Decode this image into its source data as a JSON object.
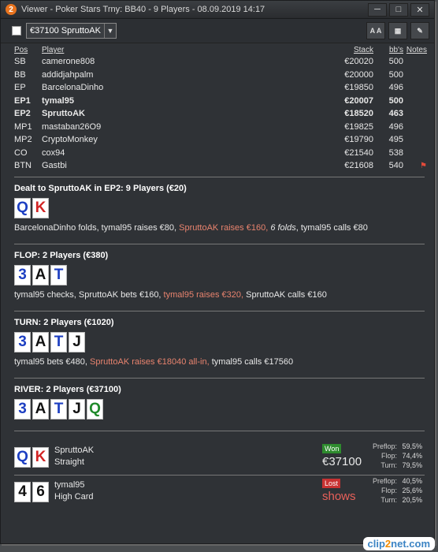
{
  "window": {
    "app_icon": "2",
    "title": "Viewer - Poker Stars Trny: BB40 - 9 Players - 08.09.2019 14:17",
    "buttons": [
      "minimize-icon",
      "maximize-icon",
      "close-icon"
    ]
  },
  "toolbar": {
    "selected_hand": "€37100 SpruttoAK",
    "font_button": "A A"
  },
  "table": {
    "headers": {
      "pos": "Pos",
      "player": "Player",
      "stack": "Stack",
      "bbs": "bb's",
      "notes": "Notes"
    },
    "rows": [
      {
        "pos": "SB",
        "player": "camerone808",
        "stack": "€20020",
        "bbs": "500",
        "bold": false
      },
      {
        "pos": "BB",
        "player": "addidjahpalm",
        "stack": "€20000",
        "bbs": "500",
        "bold": false
      },
      {
        "pos": "EP",
        "player": "BarcelonaDinho",
        "stack": "€19850",
        "bbs": "496",
        "bold": false
      },
      {
        "pos": "EP1",
        "player": "tymal95",
        "stack": "€20007",
        "bbs": "500",
        "bold": true
      },
      {
        "pos": "EP2",
        "player": "SpruttoAK",
        "stack": "€18520",
        "bbs": "463",
        "bold": true
      },
      {
        "pos": "MP1",
        "player": "mastaban26O9",
        "stack": "€19825",
        "bbs": "496",
        "bold": false
      },
      {
        "pos": "MP2",
        "player": "CryptoMonkey",
        "stack": "€19790",
        "bbs": "495",
        "bold": false
      },
      {
        "pos": "CO",
        "player": "cox94",
        "stack": "€21540",
        "bbs": "538",
        "bold": false
      },
      {
        "pos": "BTN",
        "player": "Gastbi",
        "stack": "€21608",
        "bbs": "540",
        "bold": false,
        "note_flag": true
      }
    ]
  },
  "preflop": {
    "title": "Dealt to SpruttoAK in EP2: 9 Players (€20)",
    "cards": [
      {
        "rank": "Q",
        "color": "blue"
      },
      {
        "rank": "K",
        "color": "red"
      }
    ],
    "a1": "BarcelonaDinho folds, tymal95 raises €80, ",
    "a2": "SpruttoAK raises €160, ",
    "a3": "6 folds",
    "a4": ", tymal95 calls €80"
  },
  "flop": {
    "title": "FLOP: 2 Players (€380)",
    "cards": [
      {
        "rank": "3",
        "color": "blue"
      },
      {
        "rank": "A",
        "color": "black"
      },
      {
        "rank": "T",
        "color": "blue"
      }
    ],
    "a1": "tymal95 checks, SpruttoAK bets €160, ",
    "a2": "tymal95 raises €320, ",
    "a3": "SpruttoAK calls €160"
  },
  "turn": {
    "title": "TURN: 2 Players (€1020)",
    "cards": [
      {
        "rank": "3",
        "color": "blue"
      },
      {
        "rank": "A",
        "color": "black"
      },
      {
        "rank": "T",
        "color": "blue"
      },
      {
        "rank": "J",
        "color": "black"
      }
    ],
    "a1": "tymal95 bets €480, ",
    "a2": "SpruttoAK raises €18040 all-in, ",
    "a3": "tymal95 calls €17560"
  },
  "river": {
    "title": "RIVER: 2 Players (€37100)",
    "cards": [
      {
        "rank": "3",
        "color": "blue"
      },
      {
        "rank": "A",
        "color": "black"
      },
      {
        "rank": "T",
        "color": "blue"
      },
      {
        "rank": "J",
        "color": "black"
      },
      {
        "rank": "Q",
        "color": "green"
      }
    ]
  },
  "results": [
    {
      "cards": [
        {
          "rank": "Q",
          "color": "blue"
        },
        {
          "rank": "K",
          "color": "red"
        }
      ],
      "name": "SpruttoAK",
      "hand": "Straight",
      "badge": "Won",
      "amount": "€37100",
      "stats": [
        {
          "label": "Preflop:",
          "value": "59,5%"
        },
        {
          "label": "Flop:",
          "value": "74,4%"
        },
        {
          "label": "Turn:",
          "value": "79,5%"
        }
      ]
    },
    {
      "cards": [
        {
          "rank": "4",
          "color": "black"
        },
        {
          "rank": "6",
          "color": "black"
        }
      ],
      "name": "tymal95",
      "hand": "High Card",
      "badge": "Lost",
      "amount": "shows",
      "stats": [
        {
          "label": "Preflop:",
          "value": "40,5%"
        },
        {
          "label": "Flop:",
          "value": "25,6%"
        },
        {
          "label": "Turn:",
          "value": "20,5%"
        }
      ]
    }
  ],
  "colors": {
    "highlight": "#e8836e",
    "won": "#2e8b2e",
    "lost": "#c73232",
    "card_blue": "#1d3fc2",
    "card_red": "#d22424",
    "card_green": "#1f8a2a"
  },
  "watermark": {
    "a": "clip",
    "b": "2",
    "c": "net",
    "d": ".com"
  }
}
